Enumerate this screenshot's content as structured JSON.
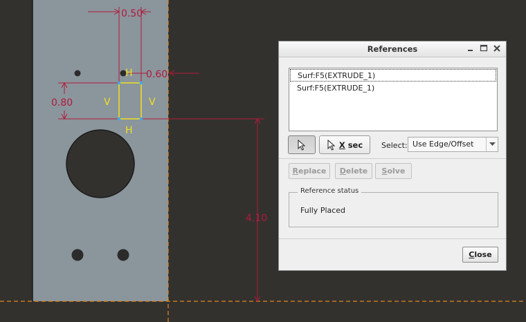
{
  "sketch": {
    "dimensions": {
      "width_top": "0.50",
      "hole_offset": "0.60",
      "height_left": "0.80",
      "vertical_right": "4.10"
    },
    "constraints": {
      "top": "H",
      "bottom": "H",
      "left": "V",
      "right": "V"
    },
    "colors": {
      "background": "#33312e",
      "part": "#8b959c",
      "dimension": "#b01a3c",
      "centerline": "#e08a1e",
      "constraint": "#f0e020",
      "vertex": "#40a8e8"
    }
  },
  "dialog": {
    "title": "References",
    "references": [
      "Surf:F5(EXTRUDE_1)",
      "Surf:F5(EXTRUDE_1)"
    ],
    "pointer_icon": "arrow-pointer-icon",
    "xsec_first": "X",
    "xsec_rest": " sec",
    "select_label": "Select:",
    "select_value": "Use Edge/Offset",
    "replace_first": "R",
    "replace_rest": "eplace",
    "delete_first": "D",
    "delete_rest": "elete",
    "solve_first": "S",
    "solve_rest": "olve",
    "status_legend": "Reference status",
    "status_value": "Fully Placed",
    "close_first": "C",
    "close_rest": "lose"
  }
}
